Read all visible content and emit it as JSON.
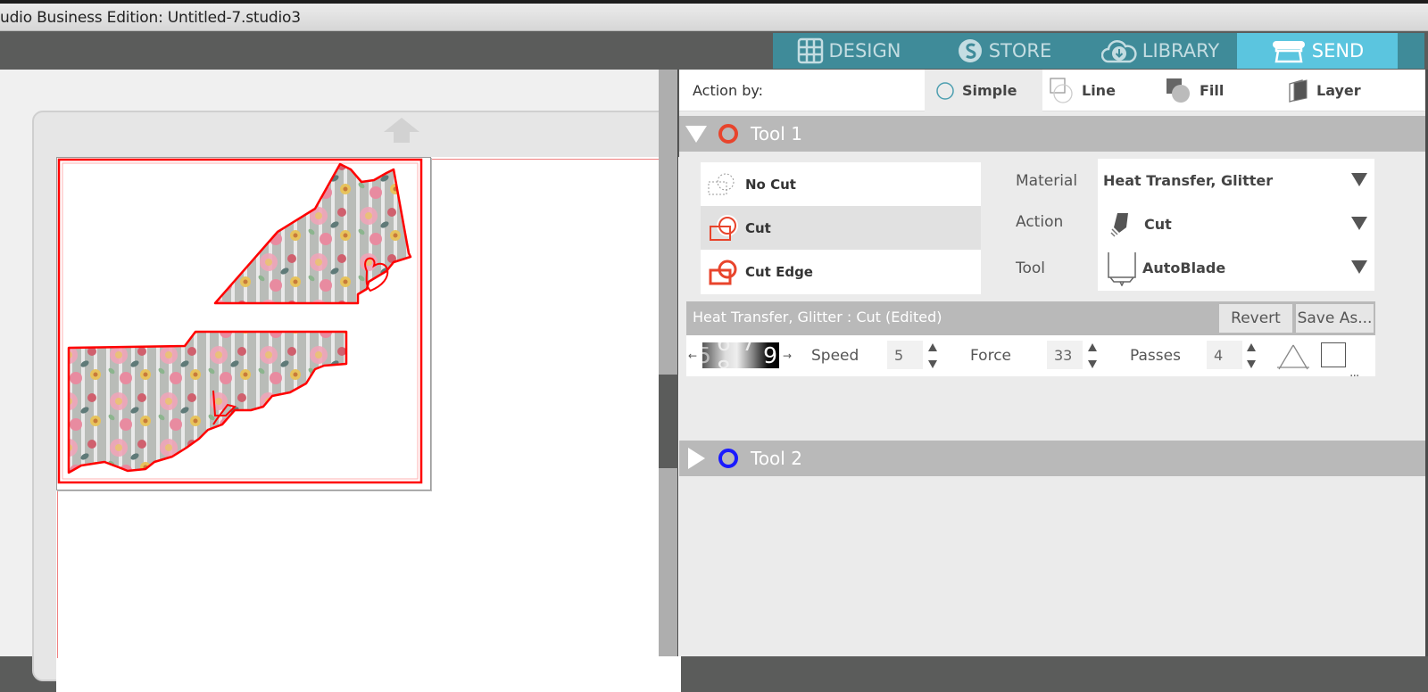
{
  "window": {
    "title": "udio Business Edition: Untitled-7.studio3"
  },
  "nav_tabs": [
    {
      "label": "DESIGN",
      "icon": "grid-icon",
      "active": false
    },
    {
      "label": "STORE",
      "icon": "silhouette-s-icon",
      "active": false
    },
    {
      "label": "LIBRARY",
      "icon": "cloud-download-icon",
      "active": false
    },
    {
      "label": "SEND",
      "icon": "cutter-machine-icon",
      "active": true
    }
  ],
  "colors": {
    "nav_bg": "#3f8b99",
    "nav_active": "#5bc5df",
    "cut_line": "#ff0000",
    "tool1_ring": "#e8442c",
    "tool2_ring": "#1a1aff"
  },
  "send_panel": {
    "action_by_label": "Action by:",
    "action_by_options": [
      {
        "label": "Simple",
        "icon": "circle-outline-icon",
        "active": true
      },
      {
        "label": "Line",
        "icon": "line-icon",
        "active": false
      },
      {
        "label": "Fill",
        "icon": "fill-icon",
        "active": false
      },
      {
        "label": "Layer",
        "icon": "layer-icon",
        "active": false
      }
    ],
    "tool1": {
      "name": "Tool 1",
      "expanded": true,
      "cut_options": [
        {
          "label": "No Cut",
          "icon": "no-cut-icon",
          "selected": false
        },
        {
          "label": "Cut",
          "icon": "cut-icon",
          "selected": true
        },
        {
          "label": "Cut Edge",
          "icon": "cut-edge-icon",
          "selected": false
        }
      ],
      "material_label": "Material",
      "material_value": "Heat Transfer, Glitter",
      "action_label": "Action",
      "action_value": "Cut",
      "tool_label": "Tool",
      "tool_value": "AutoBlade",
      "settings_title": "Heat Transfer, Glitter : Cut (Edited)",
      "revert_label": "Revert",
      "save_as_label": "Save As...",
      "blade_dial": "6 7 8",
      "blade_dial_partial_left": "5",
      "blade_dial_partial_right": "9",
      "speed_label": "Speed",
      "speed_value": "5",
      "force_label": "Force",
      "force_value": "33",
      "passes_label": "Passes",
      "passes_value": "4",
      "more_label": "..."
    },
    "tool2": {
      "name": "Tool 2",
      "expanded": false
    }
  }
}
